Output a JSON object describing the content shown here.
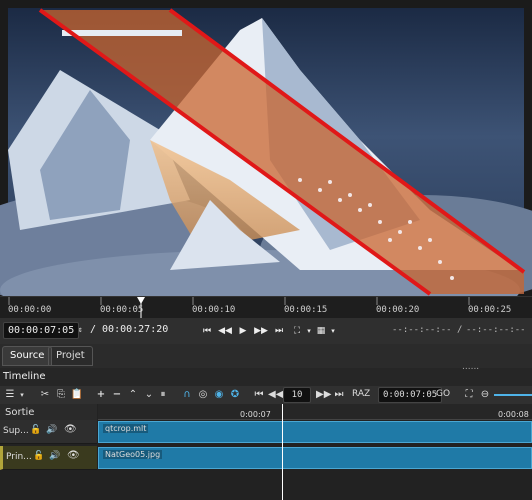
{
  "preview": {
    "image_alt": "mountain peak above clouds with flamingos strip"
  },
  "ruler": {
    "ticks": [
      "00:00:00",
      "00:00:05",
      "00:00:10",
      "00:00:15",
      "00:00:20",
      "00:00:25"
    ]
  },
  "transport": {
    "current_tc": "00:00:07:05",
    "total_tc": "/ 00:00:27:20",
    "in_out_left": "--:--:--:-- /",
    "in_out_right": "--:--:--:--"
  },
  "tabs": {
    "source": "Source",
    "project": "Projet"
  },
  "timeline": {
    "title": "Timeline",
    "dots": "......",
    "step": "10",
    "raz": "RAZ",
    "timecode": "0:00:07:05",
    "go": "GO",
    "header_label": "Sortie",
    "ruler_label_1": "0:00:07",
    "ruler_label_2": "0:00:08"
  },
  "tracks": [
    {
      "name": "Sup...",
      "clip": "qtcrop.mlt"
    },
    {
      "name": "Prin...",
      "clip": "NatGeo05.jpg"
    }
  ],
  "colors": {
    "accent": "#1f7aa7",
    "red_line": "#e01818"
  }
}
